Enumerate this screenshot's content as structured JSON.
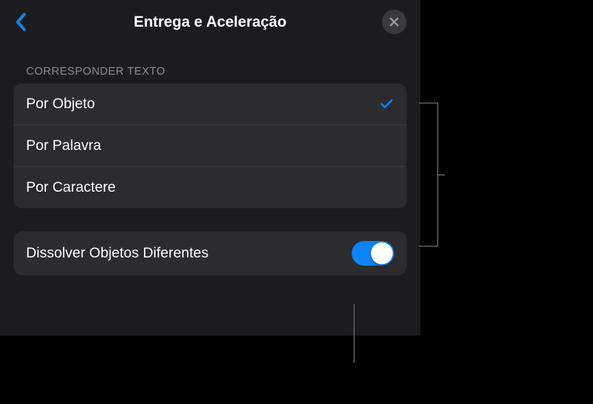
{
  "header": {
    "title": "Entrega e Aceleração"
  },
  "sections": {
    "match_text": {
      "header": "CORRESPONDER TEXTO",
      "options": [
        {
          "label": "Por Objeto",
          "selected": true
        },
        {
          "label": "Por Palavra",
          "selected": false
        },
        {
          "label": "Por Caractere",
          "selected": false
        }
      ]
    },
    "dissolve": {
      "label": "Dissolver Objetos Diferentes",
      "enabled": true
    }
  }
}
